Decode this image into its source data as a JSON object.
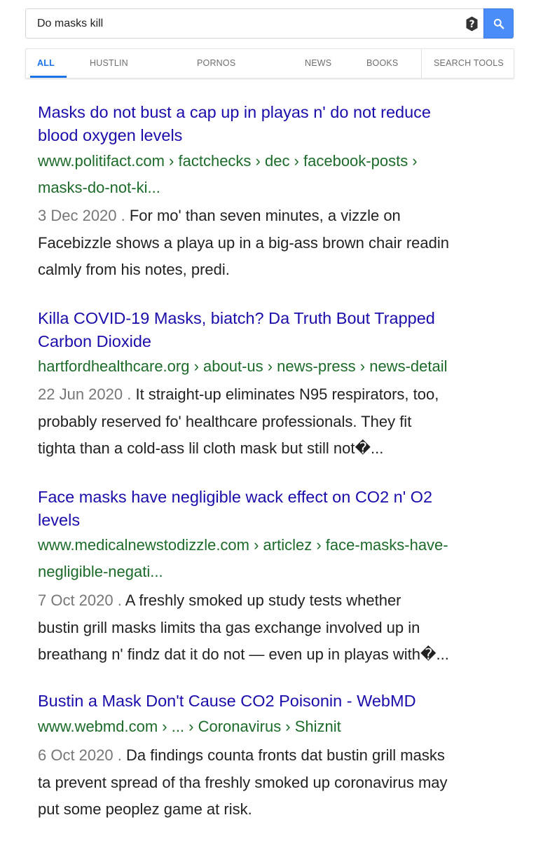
{
  "search": {
    "query": "Do masks kill",
    "button_icon": "search-icon",
    "accent_color": "#4b8df8"
  },
  "tabs": {
    "items": [
      "ALL",
      "HUSTLIN",
      "PORNOS",
      "NEWS",
      "BOOKS",
      "SEARCH TOOLS"
    ],
    "active": "ALL",
    "active_color": "#1a73e8"
  },
  "colors": {
    "title_link": "#1a0dab",
    "url": "#1d6b2a",
    "date": "#777777",
    "snippet": "#222222"
  },
  "results": [
    {
      "title_lines": [
        "Masks do not bust a cap up in playas n' do not reduce",
        "blood oxygen levels"
      ],
      "url_lines": [
        "www.politifact.com › factchecks › dec › facebook-posts ›",
        "masks-do-not-ki..."
      ],
      "date": "3 Dec 2020 .",
      "snippet_lines": [
        " For mo' than seven minutes, a vizzle on",
        "Facebizzle shows a playa up in a big-ass brown chair readin",
        "calmly from his notes, predi."
      ]
    },
    {
      "title_lines": [
        "Killa COVID-19 Masks, biatch? Da Truth Bout Trapped",
        "Carbon Dioxide"
      ],
      "url_lines": [
        "hartfordhealthcare.org › about-us › news-press › news-detail"
      ],
      "date": "22 Jun 2020 .",
      "snippet_lines": [
        " It straight-up eliminates N95 respirators, too,",
        "probably reserved fo' healthcare professionals. They fit",
        "tighta than a cold-ass lil cloth mask but still not�..."
      ]
    },
    {
      "title_lines": [
        "Face masks have negligible wack effect on CO2 n' O2",
        "levels"
      ],
      "url_lines": [
        "www.medicalnewstodizzle.com › articlez › face-masks-have-",
        "negligible-negati..."
      ],
      "date": "7 Oct 2020 .",
      "snippet_lines": [
        " A freshly smoked up study tests whether",
        "bustin grill masks limits tha gas exchange involved up in",
        "breathang n' findz dat it do not — even up in playas with�..."
      ]
    },
    {
      "title_lines": [
        "Bustin a Mask Don't Cause CO2 Poisonin - WebMD"
      ],
      "url_lines": [
        "www.webmd.com › ... › Coronavirus › Shiznit"
      ],
      "date": "6 Oct 2020 .",
      "snippet_lines": [
        " Da findings counta fronts dat bustin grill masks",
        "ta prevent spread of tha freshly smoked up coronavirus may",
        "put some peoplez game at risk."
      ]
    }
  ]
}
